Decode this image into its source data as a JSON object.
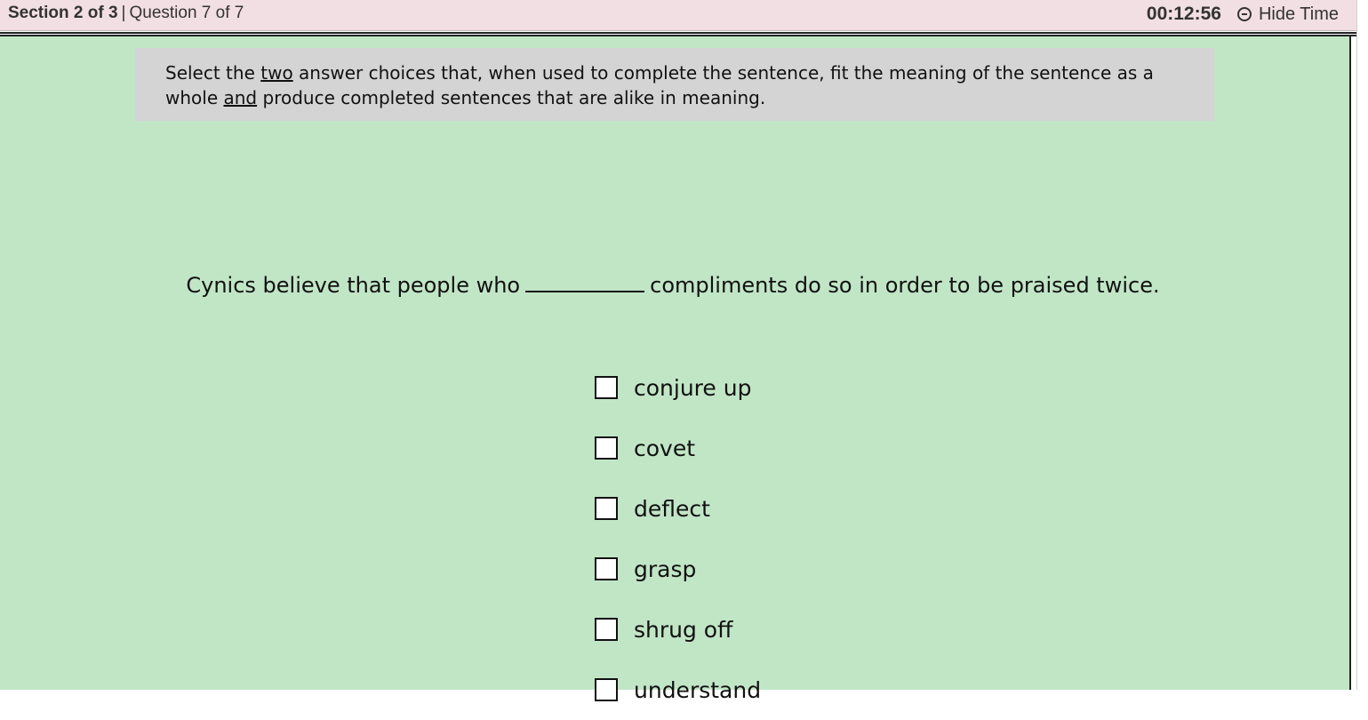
{
  "header": {
    "section": "Section 2 of 3",
    "separator": "|",
    "question_counter": "Question 7 of 7",
    "timer": "00:12:56",
    "hide_time_label": "Hide Time"
  },
  "directions": {
    "part1": "Select the ",
    "emph1": "two",
    "part2": " answer choices that, when used to complete the sentence, fit the meaning of the sentence as a whole ",
    "emph2": "and",
    "part3": " produce completed sentences that are alike in meaning."
  },
  "question": {
    "before_blank": "Cynics believe that people who",
    "after_blank": "compliments do so in order to be praised twice."
  },
  "choices": [
    {
      "label": "conjure up",
      "checked": false
    },
    {
      "label": "covet",
      "checked": false
    },
    {
      "label": "deflect",
      "checked": false
    },
    {
      "label": "grasp",
      "checked": false
    },
    {
      "label": "shrug off",
      "checked": false
    },
    {
      "label": "understand",
      "checked": false
    }
  ],
  "colors": {
    "header_bg": "#f2dfe3",
    "content_bg": "#c1e6c6",
    "directions_bg": "#d4d4d4"
  }
}
